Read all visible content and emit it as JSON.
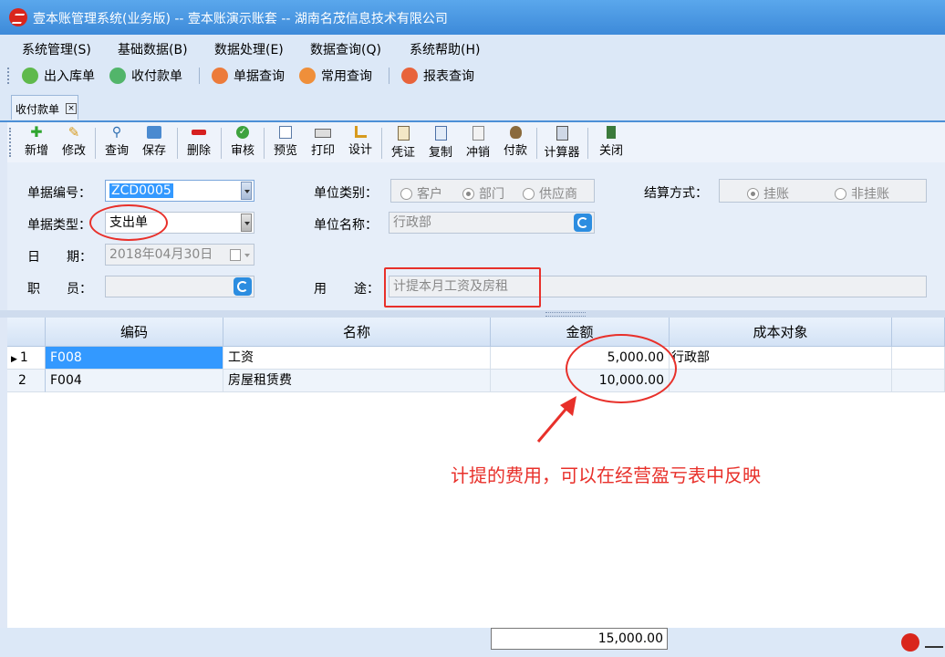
{
  "window": {
    "title": "壹本账管理系统(业务版) -- 壹本账演示账套 -- 湖南名茂信息技术有限公司"
  },
  "menu": [
    "系统管理(S)",
    "基础数据(B)",
    "数据处理(E)",
    "数据查询(Q)",
    "系统帮助(H)"
  ],
  "quick_toolbar": [
    "出入库单",
    "收付款单",
    "单据查询",
    "常用查询",
    "报表查询"
  ],
  "tab": {
    "label": "收付款单",
    "close": "×"
  },
  "toolbar": [
    "新增",
    "修改",
    "查询",
    "保存",
    "删除",
    "审核",
    "预览",
    "打印",
    "设计",
    "凭证",
    "复制",
    "冲销",
    "付款",
    "计算器",
    "关闭"
  ],
  "form": {
    "doc_no_label": "单据编号：",
    "doc_no": "ZCD0005",
    "doc_type_label": "单据类型：",
    "doc_type": "支出单",
    "date_label_a": "日",
    "date_label_b": "期：",
    "date": "2018年04月30日",
    "staff_label_a": "职",
    "staff_label_b": "员：",
    "staff": "",
    "unit_type_label": "单位类别：",
    "unit_type_options": [
      "客户",
      "部门",
      "供应商"
    ],
    "unit_type_selected": "部门",
    "unit_name_label": "单位名称：",
    "unit_name": "行政部",
    "purpose_label_a": "用",
    "purpose_label_b": "途：",
    "purpose": "计提本月工资及房租",
    "settle_label": "结算方式：",
    "settle_options": [
      "挂账",
      "非挂账"
    ],
    "settle_selected": "挂账"
  },
  "grid": {
    "columns": [
      "编码",
      "名称",
      "金额",
      "成本对象"
    ],
    "rows": [
      {
        "index": "1",
        "code": "F008",
        "name": "工资",
        "amount": "5,000.00",
        "cost_object": "行政部"
      },
      {
        "index": "2",
        "code": "F004",
        "name": "房屋租赁费",
        "amount": "10,000.00",
        "cost_object": ""
      }
    ],
    "total": "15,000.00"
  },
  "annotation": "计提的费用，可以在经营盈亏表中反映",
  "colors": {
    "accent": "#4c8fd6",
    "annotation": "#e8302a",
    "selected_cell": "#3399ff"
  }
}
